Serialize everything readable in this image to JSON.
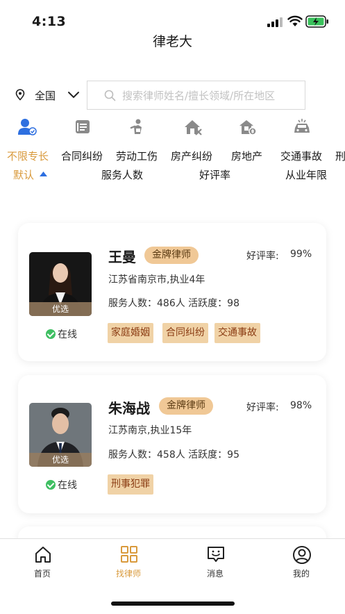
{
  "status_bar": {
    "time": "4:13"
  },
  "app": {
    "title": "律老大"
  },
  "search": {
    "region": "全国",
    "placeholder": "搜索律师姓名/擅长领域/所在地区"
  },
  "categories": [
    {
      "label": "不限专长",
      "icon": "lawyer-all-icon"
    },
    {
      "label": "合同纠纷",
      "icon": "contract-icon"
    },
    {
      "label": "劳动工伤",
      "icon": "labor-injury-icon"
    },
    {
      "label": "房产纠纷",
      "icon": "house-dispute-icon"
    },
    {
      "label": "房地产",
      "icon": "real-estate-icon"
    },
    {
      "label": "交通事故",
      "icon": "car-accident-icon"
    },
    {
      "label": "刑"
    }
  ],
  "sort": {
    "options": [
      "默认",
      "服务人数",
      "好评率",
      "从业年限"
    ]
  },
  "lawyers": [
    {
      "name": "王曼",
      "badge": "金牌律师",
      "rating_label": "好评率:",
      "rating": "99%",
      "location": "江苏省南京市,执业4年",
      "stats": "服务人数：486人 活跃度：98",
      "tags": [
        "家庭婚姻",
        "合同纠纷",
        "交通事故"
      ],
      "avatar_tag": "优选",
      "status": "在线"
    },
    {
      "name": "朱海战",
      "badge": "金牌律师",
      "rating_label": "好评率:",
      "rating": "98%",
      "location": "江苏南京,执业15年",
      "stats": "服务人数：458人 活跃度：95",
      "tags": [
        "刑事犯罪"
      ],
      "avatar_tag": "优选",
      "status": "在线"
    }
  ],
  "tabbar": {
    "items": [
      {
        "label": "首页",
        "icon": "home-icon"
      },
      {
        "label": "找律师",
        "icon": "find-lawyer-icon"
      },
      {
        "label": "消息",
        "icon": "message-icon"
      },
      {
        "label": "我的",
        "icon": "profile-icon"
      }
    ],
    "active_color": "#d99a3c"
  },
  "colors": {
    "accent": "#d99a3c",
    "badge_bg": "#f0c896",
    "tag_bg": "#f0d2a6",
    "tag_text": "#8a3b12",
    "online": "#3fbf62"
  }
}
